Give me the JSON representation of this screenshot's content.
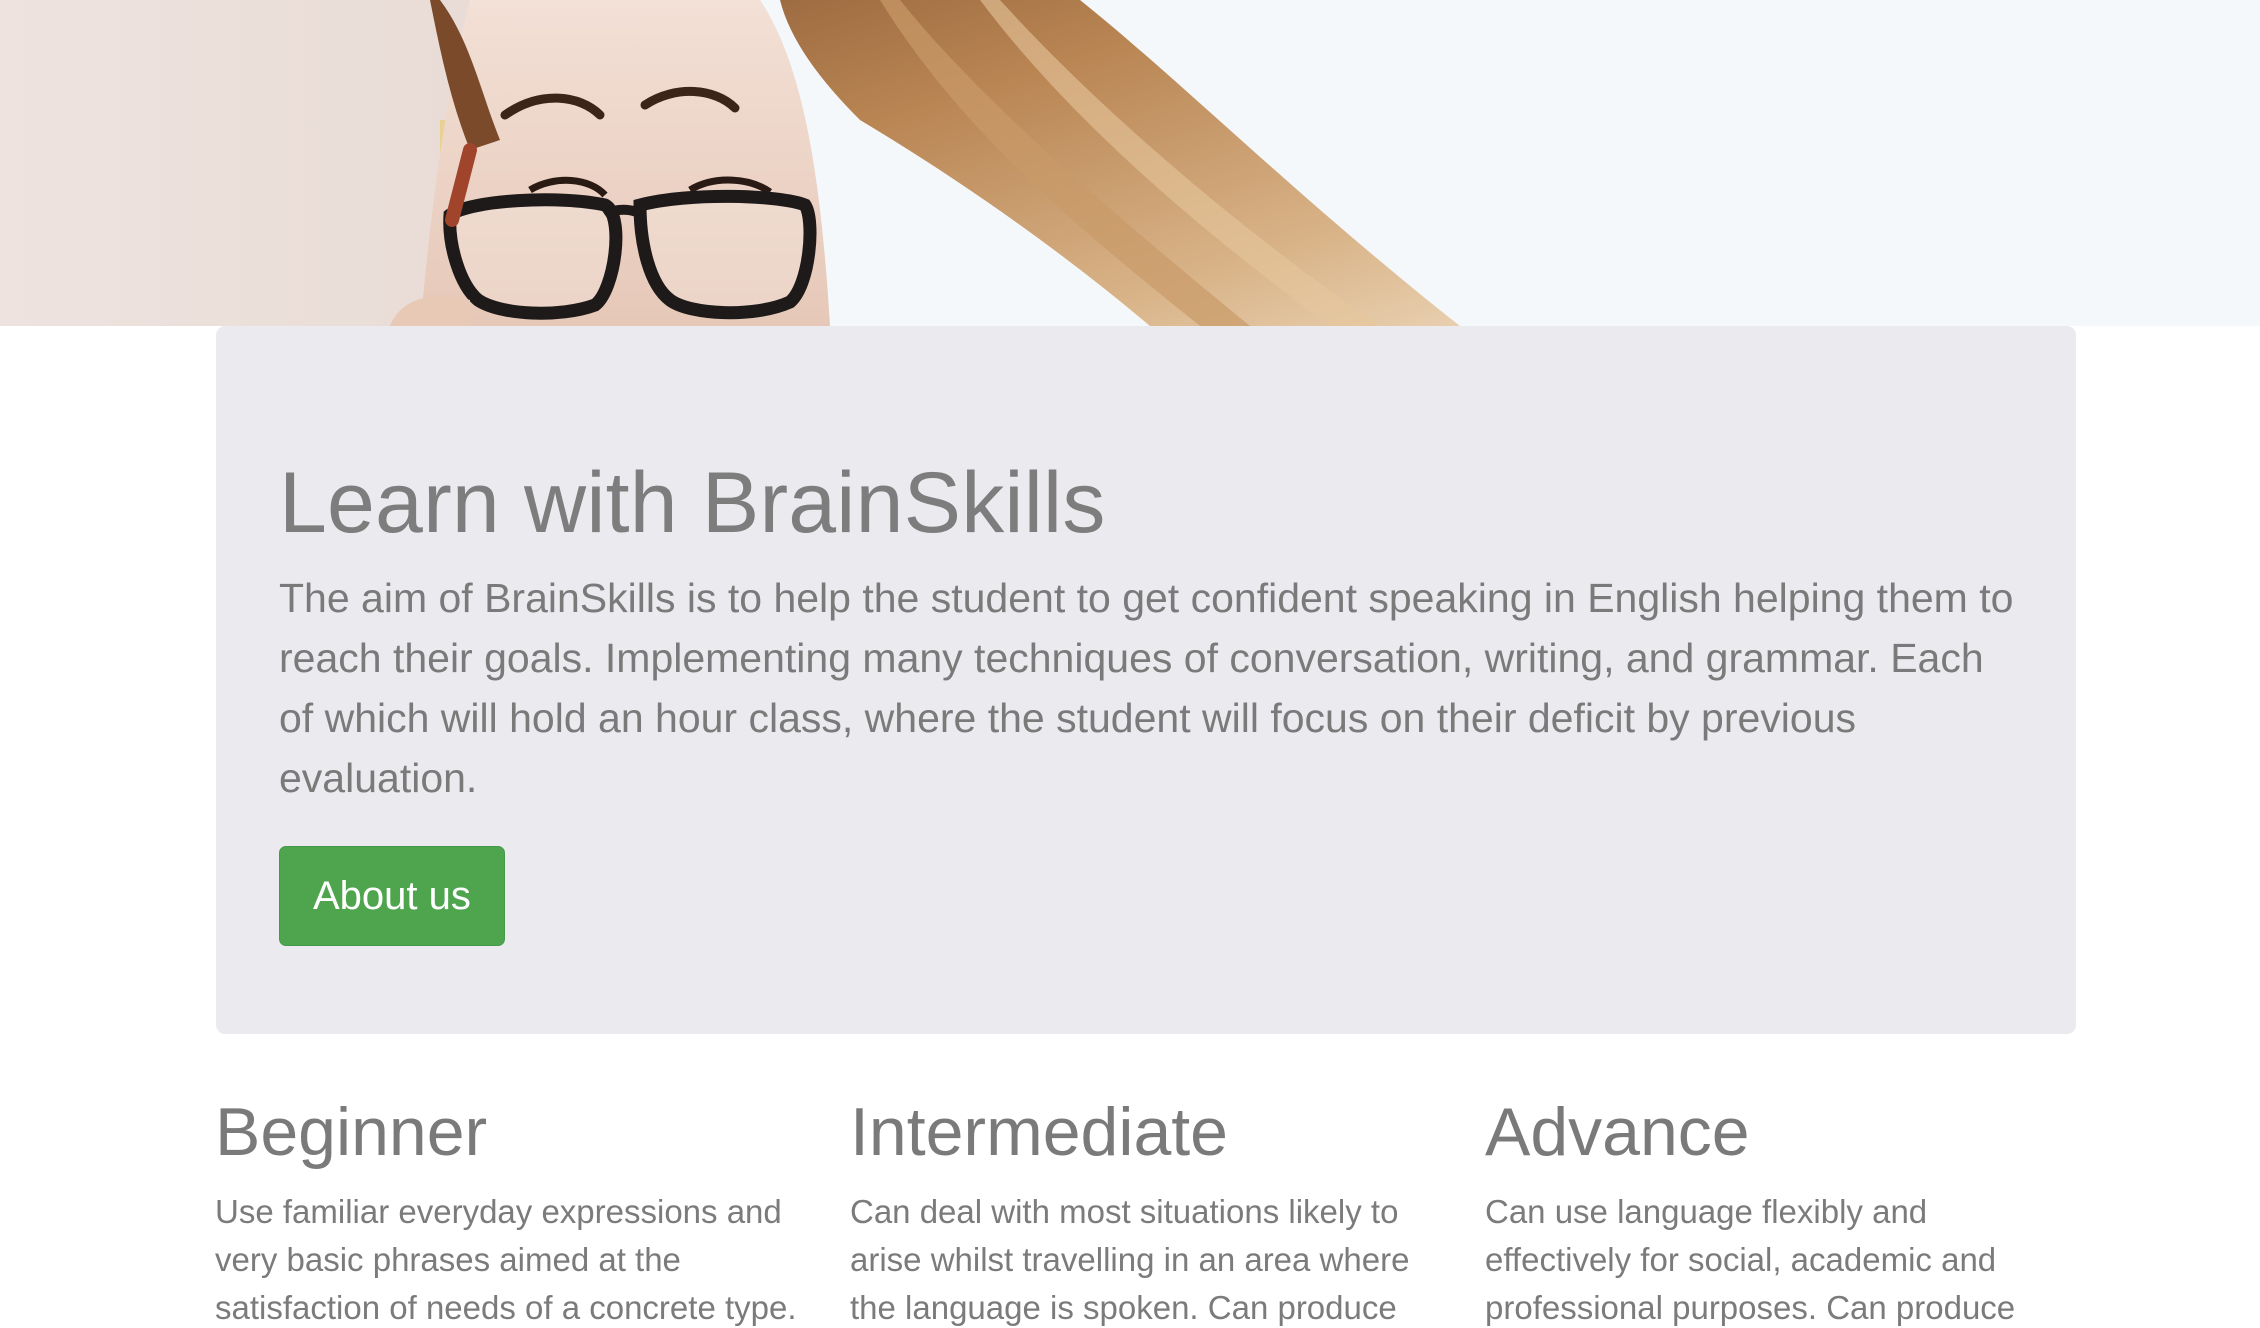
{
  "hero": {
    "image_alt": "Student with glasses reading"
  },
  "jumbotron": {
    "title": "Learn with BrainSkills",
    "text": "The aim of BrainSkills is to help the student to get confident speaking in English helping them to reach their goals. Implementing many techniques of conversation, writing, and grammar. Each of which will hold an hour class, where the student will focus on their deficit by previous evaluation.",
    "button_label": "About us"
  },
  "levels": [
    {
      "title": "Beginner",
      "text": "Use familiar everyday expressions and very basic phrases aimed at the satisfaction of needs of a concrete type."
    },
    {
      "title": "Intermediate",
      "text": "Can deal with most situations likely to arise whilst travelling in an area where the language is spoken. Can produce"
    },
    {
      "title": "Advance",
      "text": "Can use language flexibly and effectively for social, academic and professional purposes. Can produce clear, well-"
    }
  ],
  "colors": {
    "button_bg": "#4ea54e",
    "jumbotron_bg": "#ebebef",
    "text": "#7f7f7f"
  }
}
